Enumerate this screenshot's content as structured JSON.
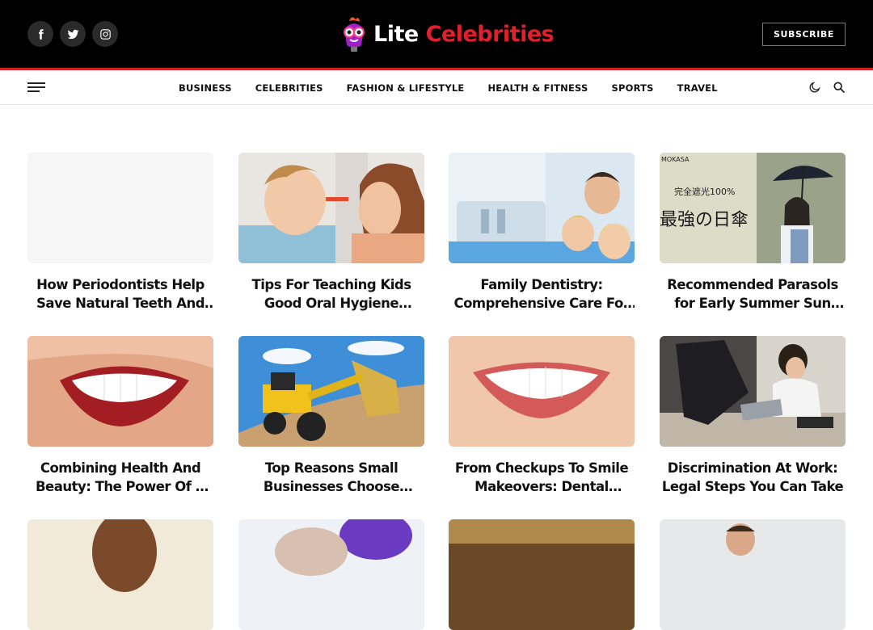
{
  "header": {
    "logo_white": "Lite",
    "logo_red": " Celebrities",
    "subscribe_label": "SUBSCRIBE",
    "social": [
      {
        "icon": "facebook-icon"
      },
      {
        "icon": "twitter-icon"
      },
      {
        "icon": "instagram-icon"
      }
    ]
  },
  "nav": {
    "items": [
      {
        "label": "BUSINESS"
      },
      {
        "label": "CELEBRITIES"
      },
      {
        "label": "FASHION & LIFESTYLE"
      },
      {
        "label": "HEALTH & FITNESS"
      },
      {
        "label": "SPORTS"
      },
      {
        "label": "TRAVEL"
      }
    ],
    "icons": [
      "dark-mode-moon-icon",
      "search-icon"
    ]
  },
  "posts": [
    {
      "title": "How Periodontists Help Save Natural Teeth And Gums",
      "image": "blank-placeholder"
    },
    {
      "title": "Tips For Teaching Kids Good Oral Hygiene Habits Early",
      "image": "mother-brushing-child-teeth"
    },
    {
      "title": "Family Dentistry: Comprehensive Care For All Ages",
      "image": "family-at-dentist"
    },
    {
      "title": "Recommended Parasols for Early Summer Sun Protection",
      "image": "woman-with-umbrella-ad",
      "image_text": [
        "MOKASA",
        "完全遮光100%",
        "最強の日傘"
      ]
    },
    {
      "title": "Combining Health And Beauty: The Power Of A Smile",
      "image": "smile-closeup"
    },
    {
      "title": "Top Reasons Small Businesses Choose Equipment Rental",
      "image": "yellow-excavator"
    },
    {
      "title": "From Checkups To Smile Makeovers: Dental Services",
      "image": "smile-closeup-2"
    },
    {
      "title": "Discrimination At Work: Legal Steps You Can Take",
      "image": "stressed-woman-at-desk"
    },
    {
      "title": "",
      "image": "smiling-woman"
    },
    {
      "title": "",
      "image": "dental-procedure"
    },
    {
      "title": "",
      "image": "autumn-street"
    },
    {
      "title": "",
      "image": "man-in-office"
    }
  ]
}
